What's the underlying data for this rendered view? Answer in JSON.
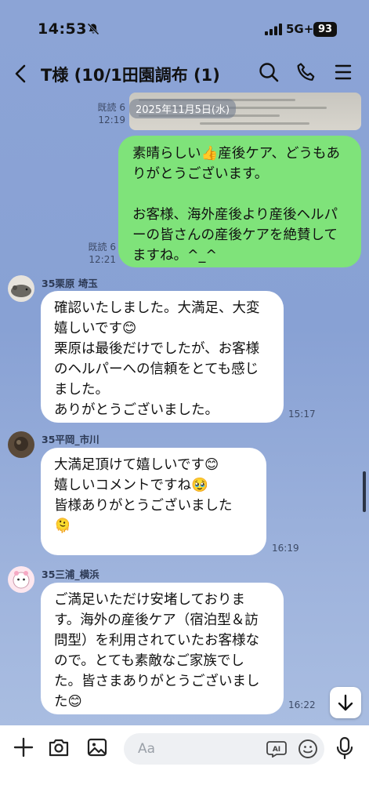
{
  "status_bar": {
    "time": "14:53",
    "network": "5G+",
    "battery": "93"
  },
  "header": {
    "title": "T様 (10/1田園調布 (1)"
  },
  "shared_image": {
    "date_overlay": "2025年11月5日(水)",
    "read_label": "既読 6",
    "time": "12:19"
  },
  "messages": [
    {
      "type": "sent",
      "text": "素晴らしい👍産後ケア、どうもありがとうございます。\n\nお客様、海外産後より産後ヘルパーの皆さんの産後ケアを絶賛してますね。^_^",
      "read_label": "既読 6",
      "time": "12:21"
    },
    {
      "type": "received",
      "sender": "35栗原 埼玉",
      "text": "確認いたしました。大満足、大変嬉しいです😊\n栗原は最後だけでしたが、お客様のヘルパーへの信頼をとても感じました。\nありがとうございました。",
      "time": "15:17"
    },
    {
      "type": "received",
      "sender": "35平岡_市川",
      "text": "大満足頂けて嬉しいです😊\n嬉しいコメントですね🥹\n皆様ありがとうございました\n🫠",
      "time": "16:19"
    },
    {
      "type": "received",
      "sender": "35三浦_横浜",
      "text": "ご満足いただけ安堵しております。海外の産後ケア（宿泊型＆訪問型）を利用されていたお客様なので。とても素敵なご家族でした。皆さまありがとうございました😊",
      "time": "16:22"
    }
  ],
  "input": {
    "placeholder": "Aa"
  },
  "colors": {
    "chat_bg": "#8aa3d6",
    "sent_bubble": "#7fe37a",
    "received_bubble": "#ffffff"
  }
}
